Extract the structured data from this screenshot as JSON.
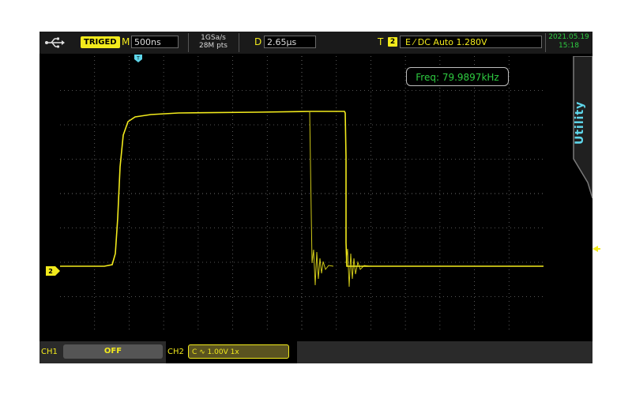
{
  "top_bar": {
    "usb_icon": "usb-icon",
    "trigger_status": "TRIGED",
    "timebase_label": "M",
    "timebase_value": "500ns",
    "sample_rate": "1GSa/s",
    "memory_depth": "28M pts",
    "delay_label": "D",
    "delay_value": "2.65µs",
    "trigger_label": "T",
    "trigger_channel": "2",
    "trigger_settings": "E ⁄ DC Auto 1.280V",
    "date": "2021.05.19",
    "time": "15:18"
  },
  "screen": {
    "measurement": "Freq: 79.9897kHz",
    "channel_marker": "2",
    "trigger_position_marker": "T"
  },
  "side_menu": {
    "utility_label": "Utility"
  },
  "bottom_bar": {
    "ch1_label": "CH1",
    "ch1_status": "OFF",
    "ch2_label": "CH2",
    "ch2_settings": "C ∿ 1.00V 1x"
  },
  "colors": {
    "trace": "#f2ea1c",
    "measurement_text": "#2ecc40",
    "utility_text": "#5fd6ea",
    "grid": "#6f6f6f"
  }
}
